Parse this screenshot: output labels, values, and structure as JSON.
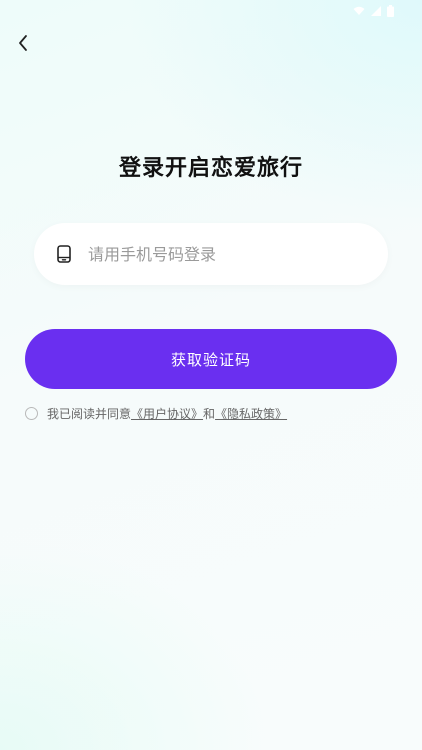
{
  "header": {
    "title": "登录开启恋爱旅行"
  },
  "login": {
    "phone_placeholder": "请用手机号码登录",
    "phone_value": "",
    "submit_label": "获取验证码"
  },
  "agreement": {
    "prefix": "我已阅读并同意",
    "user_agreement": "《用户协议》",
    "conjunction": "和",
    "privacy_policy": "《隐私政策》",
    "checked": false
  },
  "icons": {
    "back": "chevron-left-icon",
    "phone": "phone-icon",
    "wifi": "wifi-icon",
    "signal": "signal-icon",
    "battery": "battery-icon"
  },
  "colors": {
    "accent": "#6a2ff0",
    "title": "#111111",
    "placeholder": "#9a9a9a"
  }
}
